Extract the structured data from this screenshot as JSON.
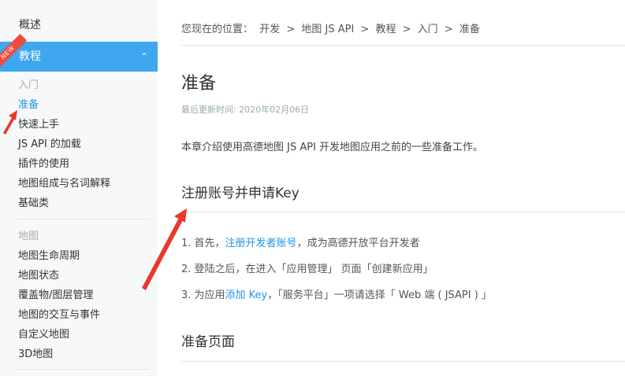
{
  "sidebar": {
    "overview": "概述",
    "tutorial": "教程",
    "new_ribbon": "NEW",
    "sections": [
      {
        "caption": "入门",
        "items": [
          "准备",
          "快速上手",
          "JS API 的加载",
          "插件的使用",
          "地图组成与名词解释",
          "基础类"
        ]
      },
      {
        "caption": "地图",
        "items": [
          "地图生命周期",
          "地图状态",
          "覆盖物/图层管理",
          "地图的交互与事件",
          "自定义地图",
          "3D地图"
        ]
      }
    ]
  },
  "breadcrumb": {
    "prefix": "您现在的位置：",
    "items": [
      "开发",
      "地图 JS API",
      "教程",
      "入门",
      "准备"
    ],
    "sep": ">"
  },
  "article": {
    "title": "准备",
    "updated": "最后更新时间: 2020年02月06日",
    "intro": "本章介绍使用高德地图 JS API 开发地图应用之前的一些准备工作。",
    "section1_title": "注册账号并申请Key",
    "step1_pre": "1. 首先，",
    "step1_link": "注册开发者账号",
    "step1_post": "，成为高德开放平台开发者",
    "step2": "2. 登陆之后，在进入「应用管理」 页面「创建新应用」",
    "step3_pre": "3. 为应用",
    "step3_link": "添加 Key",
    "step3_post": "，「服务平台」一项请选择「 Web 端 ( JSAPI ) 」",
    "section2_title": "准备页面"
  },
  "colors": {
    "accent": "#3fa6f0",
    "link": "#2196e8",
    "annotation": "#e8392c"
  }
}
